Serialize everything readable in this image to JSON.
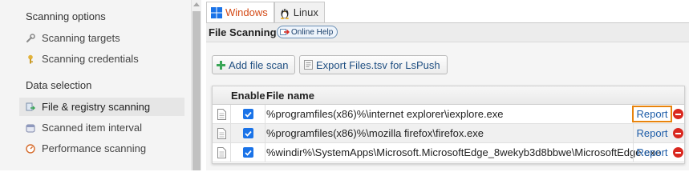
{
  "sidebar": {
    "sections": [
      {
        "title": "Scanning options",
        "items": [
          {
            "label": "Scanning targets",
            "icon": "wrench-icon"
          },
          {
            "label": "Scanning credentials",
            "icon": "key-icon"
          }
        ]
      },
      {
        "title": "Data selection",
        "items": [
          {
            "label": "File & registry scanning",
            "icon": "file-scan-icon",
            "active": true
          },
          {
            "label": "Scanned item interval",
            "icon": "calendar-icon"
          },
          {
            "label": "Performance scanning",
            "icon": "gauge-icon"
          }
        ]
      }
    ]
  },
  "tabs": [
    {
      "label": "Windows",
      "icon": "windows-icon",
      "active": true,
      "color": "#d44a16"
    },
    {
      "label": "Linux",
      "icon": "linux-icon",
      "active": false
    }
  ],
  "panel": {
    "title": "File Scanning",
    "help_label": "Online Help"
  },
  "toolbar": {
    "add_label": "Add file scan",
    "export_label": "Export Files.tsv for LsPush"
  },
  "grid": {
    "columns": [
      "",
      "Enable",
      "File name"
    ],
    "rows": [
      {
        "enabled": true,
        "file_name": "%programfiles(x86)%\\internet explorer\\iexplore.exe",
        "report_label": "Report",
        "focused": true
      },
      {
        "enabled": true,
        "file_name": "%programfiles(x86)%\\mozilla firefox\\firefox.exe",
        "report_label": "Report",
        "focused": false
      },
      {
        "enabled": true,
        "file_name": "%windir%\\SystemApps\\Microsoft.MicrosoftEdge_8wekyb3d8bbwe\\MicrosoftEdge.exe",
        "report_label": "Report",
        "focused": false
      }
    ]
  },
  "colors": {
    "accent": "#1a73e8",
    "link": "#1e5da8",
    "focus_ring": "#e8830c",
    "delete": "#d9281f"
  }
}
